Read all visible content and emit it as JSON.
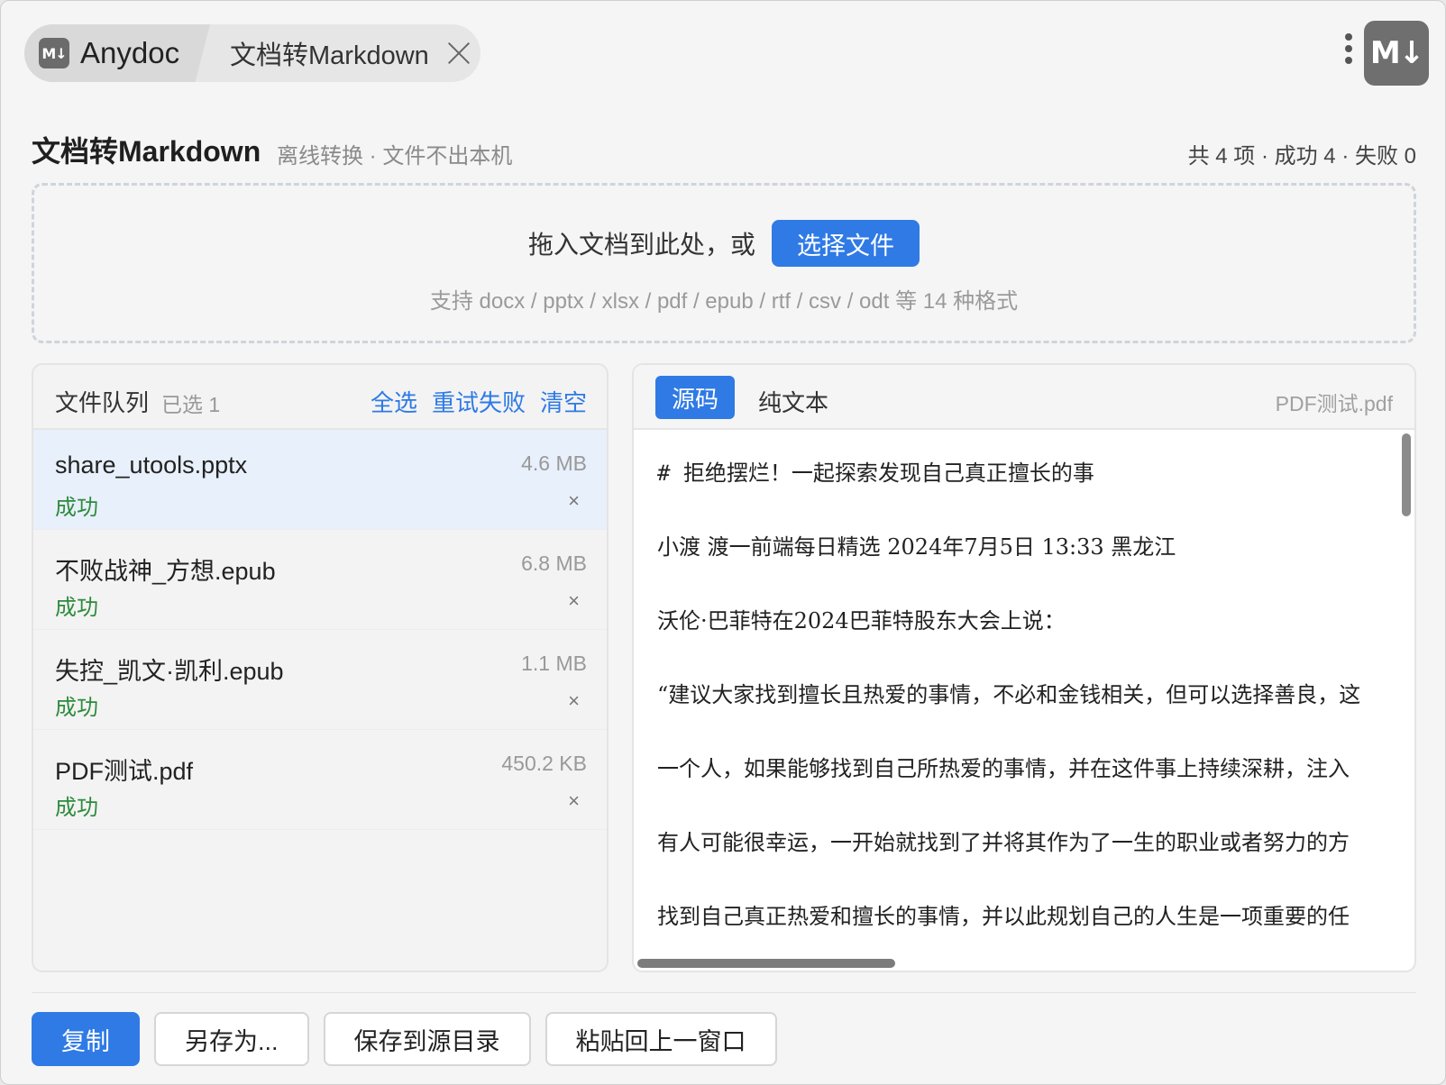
{
  "app": {
    "logo_text": "M↓",
    "name": "Anydoc",
    "tab_label": "文档转Markdown",
    "badge_text": "M↓"
  },
  "header": {
    "title": "文档转Markdown",
    "subtitle": "离线转换 · 文件不出本机",
    "stats": "共 4 项 · 成功 4 · 失败 0"
  },
  "dropzone": {
    "prompt": "拖入文档到此处，或",
    "select_button": "选择文件",
    "formats": "支持 docx / pptx / xlsx / pdf / epub / rtf / csv / odt 等 14 种格式"
  },
  "queue": {
    "title": "文件队列",
    "selected": "已选 1",
    "actions": {
      "select_all": "全选",
      "retry_failed": "重试失败",
      "clear": "清空"
    },
    "items": [
      {
        "name": "share_utools.pptx",
        "size": "4.6 MB",
        "status": "成功",
        "remove": "×"
      },
      {
        "name": "不败战神_方想.epub",
        "size": "6.8 MB",
        "status": "成功",
        "remove": "×"
      },
      {
        "name": "失控_凯文·凯利.epub",
        "size": "1.1 MB",
        "status": "成功",
        "remove": "×"
      },
      {
        "name": "PDF测试.pdf",
        "size": "450.2 KB",
        "status": "成功",
        "remove": "×"
      }
    ]
  },
  "preview": {
    "tab_source": "源码",
    "tab_plain": "纯文本",
    "file_name": "PDF测试.pdf",
    "lines": [
      "# 拒绝摆烂！一起探索发现自己真正擅长的事",
      "小渡 渡一前端每日精选 2024年7月5日 13:33 黑龙江",
      "沃伦·巴菲特在2024巴菲特股东大会上说：",
      "“建议大家找到擅长且热爱的事情，不必和金钱相关，但可以选择善良，这",
      "一个人，如果能够找到自己所热爱的事情，并在这件事上持续深耕，注入",
      "有人可能很幸运，一开始就找到了并将其作为了一生的职业或者努力的方",
      "找到自己真正热爱和擅长的事情，并以此规划自己的人生是一项重要的任"
    ]
  },
  "footer": {
    "copy": "复制",
    "save_as": "另存为...",
    "save_to_source": "保存到源目录",
    "paste_back": "粘贴回上一窗口"
  }
}
